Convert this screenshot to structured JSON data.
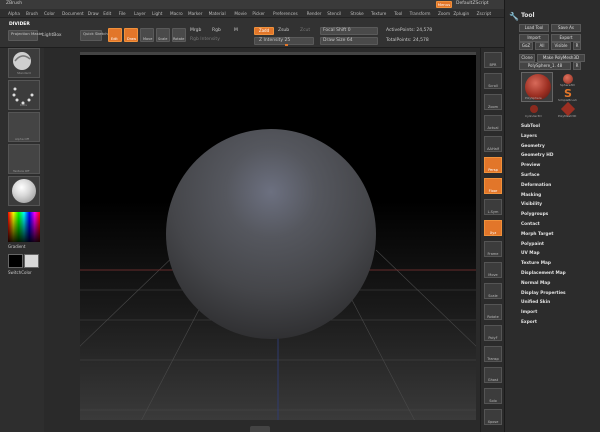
{
  "window": {
    "title": "ZBrush"
  },
  "menu": [
    "Alpha",
    "Brush",
    "Color",
    "Document",
    "Draw",
    "Edit",
    "File",
    "Layer",
    "Light",
    "Macro",
    "Marker",
    "Material",
    "Movie",
    "Picker",
    "Preferences",
    "Render",
    "Stencil",
    "Stroke",
    "Texture",
    "Tool",
    "Transform",
    "Zoom",
    "Zplugin",
    "Zscript"
  ],
  "script": {
    "badge": "Menus",
    "name": "DefaultZScript"
  },
  "toolbar": {
    "projection_master": "Projection Master",
    "lightbox": "LightBox",
    "quick_sketch": "Quick Sketch",
    "divider": "DIVIDER",
    "edit": "Edit",
    "draw": "Draw",
    "move": "Move",
    "scale": "Scale",
    "rotate": "Rotate",
    "mrgb": "Mrgb",
    "rgb": "Rgb",
    "m": "M",
    "rgb_intensity": "Rgb Intensity",
    "zadd": "Zadd",
    "zsub": "Zsub",
    "zcut": "Zcut",
    "z_intensity": "Z Intensity 25",
    "focal_shift": "Focal Shift 0",
    "draw_size": "Draw Size 64",
    "active_points": "ActivePoints: 24,578",
    "total_points": "TotalPoints: 24,578"
  },
  "left": {
    "gradient": "Gradient",
    "switch_color": "SwitchColor",
    "standard": "Standard",
    "dots": "Dots",
    "alpha_off": "Alpha Off",
    "texture_off": "Texture Off",
    "color": "#d9d9d9"
  },
  "right_strip": [
    "BPR",
    "Scroll",
    "Zoom",
    "Actual",
    "AAHalf",
    "Persp",
    "Floor",
    "L.Sym",
    "Xyz",
    "Frame",
    "Move",
    "Scale",
    "Rotate",
    "PolyF",
    "Transp",
    "Ghost",
    "Solo",
    "Xpose"
  ],
  "tool_panel": {
    "title": "Tool",
    "load_tool": "Load Tool",
    "save_as": "Save As",
    "import": "Import",
    "export": "Export",
    "goz": "GoZ",
    "all": "All",
    "visible": "Visible",
    "r": "R",
    "clone": "Clone",
    "make_polymesh": "Make PolyMesh3D",
    "current_tool": "PolySphere_1. 48",
    "tools": [
      "PolySphere",
      "Sphere3D",
      "SimpleBrush",
      "Cylinder3D",
      "PolyMesh3D"
    ],
    "sections": [
      "SubTool",
      "Layers",
      "Geometry",
      "Geometry HD",
      "Preview",
      "Surface",
      "Deformation",
      "Masking",
      "Visibility",
      "Polygroups",
      "Contact",
      "Morph Target",
      "Polypaint",
      "UV Map",
      "Texture Map",
      "Displacement Map",
      "Normal Map",
      "Display Properties",
      "Unified Skin",
      "Import",
      "Export"
    ]
  },
  "colors": {
    "accent": "#e2762a",
    "bg": "#2b2b2b"
  }
}
